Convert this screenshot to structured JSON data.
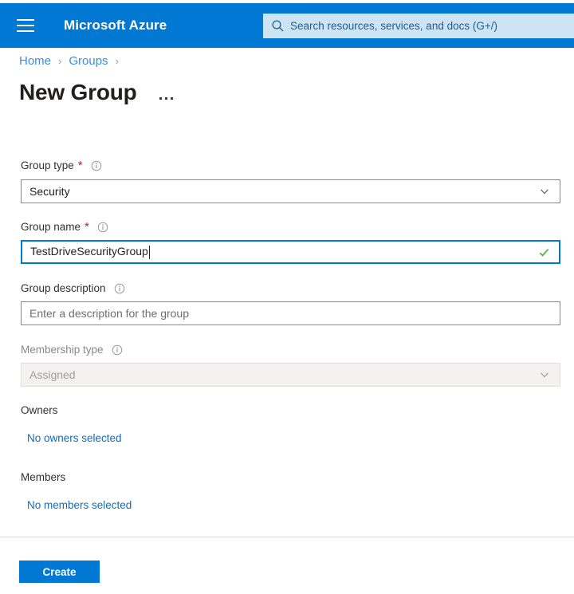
{
  "colors": {
    "azure_blue": "#0078d4",
    "search_bg": "#cde4f5",
    "link_blue": "#0f6cbd",
    "breadcrumb_blue": "#3b8ce8",
    "required_red": "#a4262c",
    "valid_green": "#5bb82b",
    "disabled_bg": "#f3f2f1"
  },
  "header": {
    "menu_icon": "hamburger-icon",
    "brand": "Microsoft Azure",
    "search": {
      "icon": "search-icon",
      "placeholder": "Search resources, services, and docs (G+/)",
      "value": ""
    }
  },
  "breadcrumb": {
    "items": [
      {
        "label": "Home"
      },
      {
        "label": "Groups"
      }
    ],
    "separator": "›"
  },
  "page": {
    "title": "New Group",
    "more_menu": "···"
  },
  "form": {
    "group_type": {
      "label": "Group type",
      "required": "*",
      "info_icon": "info-icon",
      "value": "Security",
      "chevron_icon": "chevron-down-icon"
    },
    "group_name": {
      "label": "Group name",
      "required": "*",
      "info_icon": "info-icon",
      "value": "TestDriveSecurityGroup",
      "validation_icon": "checkmark-icon",
      "focused": true
    },
    "group_description": {
      "label": "Group description",
      "info_icon": "info-icon",
      "value": "",
      "placeholder": "Enter a description for the group"
    },
    "membership_type": {
      "label": "Membership type",
      "info_icon": "info-icon",
      "value": "Assigned",
      "disabled": true,
      "chevron_icon": "chevron-down-icon"
    }
  },
  "sections": {
    "owners": {
      "label": "Owners",
      "link": "No owners selected"
    },
    "members": {
      "label": "Members",
      "link": "No members selected"
    }
  },
  "footer": {
    "create_label": "Create"
  }
}
